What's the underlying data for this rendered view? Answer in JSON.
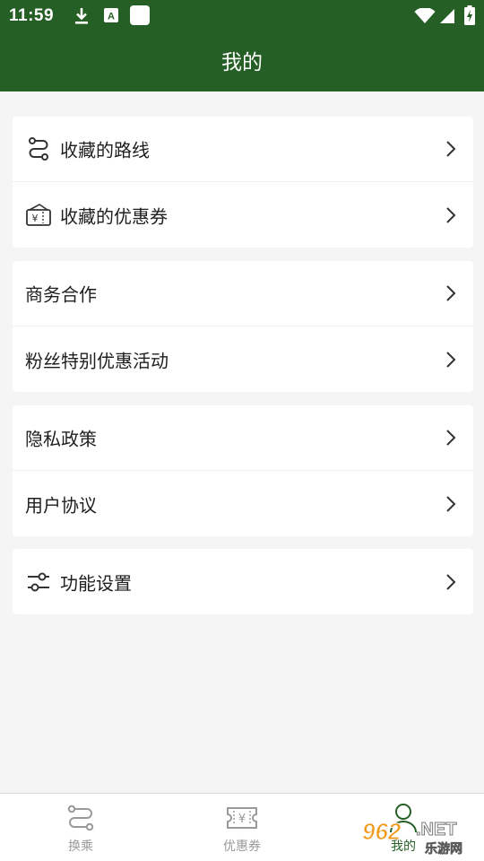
{
  "status_bar": {
    "time": "11:59",
    "icons": [
      "download-icon",
      "a-icon",
      "square-icon",
      "wifi-icon",
      "signal-icon",
      "battery-icon"
    ]
  },
  "header": {
    "title": "我的"
  },
  "groups": [
    {
      "items": [
        {
          "label": "收藏的路线",
          "icon": "route-icon"
        },
        {
          "label": "收藏的优惠券",
          "icon": "coupon-icon"
        }
      ]
    },
    {
      "items": [
        {
          "label": "商务合作"
        },
        {
          "label": "粉丝特别优惠活动"
        }
      ]
    },
    {
      "items": [
        {
          "label": "隐私政策"
        },
        {
          "label": "用户协议"
        }
      ]
    },
    {
      "items": [
        {
          "label": "功能设置",
          "icon": "sliders-icon"
        }
      ]
    }
  ],
  "bottom_nav": {
    "items": [
      {
        "label": "换乘",
        "icon": "transfer-icon"
      },
      {
        "label": "优惠券",
        "icon": "ticket-icon"
      },
      {
        "label": "我的",
        "icon": "user-icon",
        "active": true
      }
    ]
  },
  "watermark": {
    "number": "962",
    "suffix": ".NET",
    "text": "乐游网"
  },
  "colors": {
    "primary": "#265f26",
    "background": "#f5f5f5",
    "text": "#1f1f1f",
    "muted": "#9a9a9a"
  }
}
